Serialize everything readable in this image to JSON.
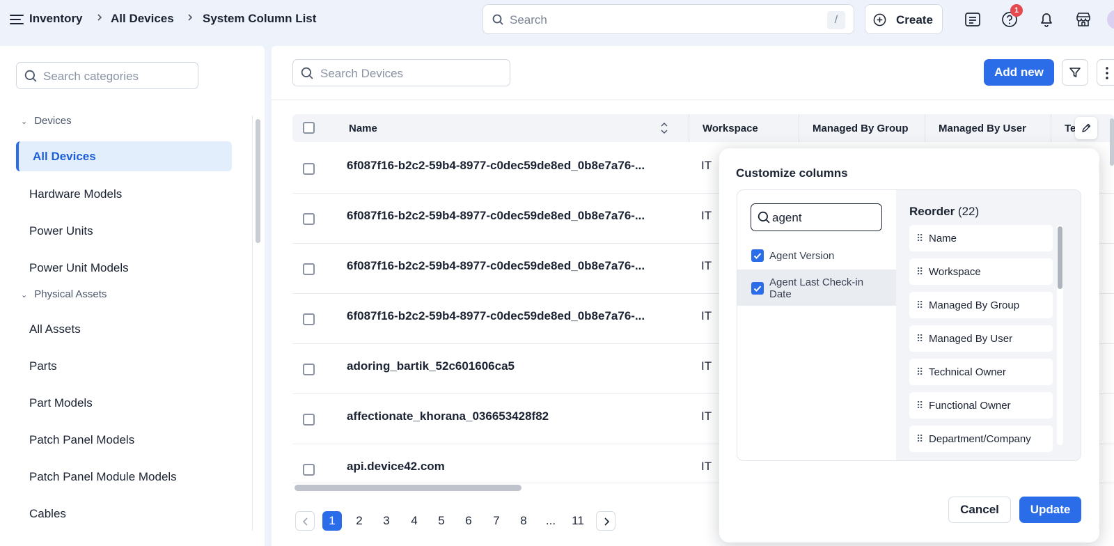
{
  "breadcrumb": {
    "items": [
      "Inventory",
      "All Devices",
      "System Column List"
    ]
  },
  "header": {
    "search_placeholder": "Search",
    "search_shortcut": "/",
    "create_label": "Create",
    "notification_badge": "1"
  },
  "sidebar": {
    "search_placeholder": "Search categories",
    "groups": [
      {
        "label": "Devices",
        "items": [
          "All Devices",
          "Hardware Models",
          "Power Units",
          "Power Unit Models"
        ]
      },
      {
        "label": "Physical Assets",
        "items": [
          "All Assets",
          "Parts",
          "Part Models",
          "Patch Panel Models",
          "Patch Panel Module Models",
          "Cables"
        ]
      }
    ],
    "active_item": "All Devices"
  },
  "main": {
    "search_placeholder": "Search Devices",
    "add_new_label": "Add new",
    "table": {
      "columns": [
        "Name",
        "Workspace",
        "Managed By Group",
        "Managed By User",
        "Te"
      ],
      "rows": [
        {
          "name": "6f087f16-b2c2-59b4-8977-c0dec59de8ed_0b8e7a76-...",
          "workspace": "IT"
        },
        {
          "name": "6f087f16-b2c2-59b4-8977-c0dec59de8ed_0b8e7a76-...",
          "workspace": "IT"
        },
        {
          "name": "6f087f16-b2c2-59b4-8977-c0dec59de8ed_0b8e7a76-...",
          "workspace": "IT"
        },
        {
          "name": "6f087f16-b2c2-59b4-8977-c0dec59de8ed_0b8e7a76-...",
          "workspace": "IT"
        },
        {
          "name": "adoring_bartik_52c601606ca5",
          "workspace": "IT"
        },
        {
          "name": "affectionate_khorana_036653428f82",
          "workspace": "IT"
        },
        {
          "name": "api.device42.com",
          "workspace": "IT"
        }
      ]
    },
    "pagination": {
      "pages": [
        "1",
        "2",
        "3",
        "4",
        "5",
        "6",
        "7",
        "8",
        "...",
        "11"
      ],
      "current": "1"
    }
  },
  "customize": {
    "title": "Customize columns",
    "search_value": "agent",
    "results": [
      {
        "label": "Agent Version",
        "checked": true
      },
      {
        "label": "Agent Last Check-in Date",
        "checked": true
      }
    ],
    "reorder_label": "Reorder",
    "reorder_count": "(22)",
    "reorder_items": [
      "Name",
      "Workspace",
      "Managed By Group",
      "Managed By User",
      "Technical Owner",
      "Functional Owner",
      "Department/Company"
    ],
    "cancel_label": "Cancel",
    "update_label": "Update"
  },
  "colors": {
    "accent": "#2b6de8",
    "active_bg": "#e3eefd",
    "badge": "#e5484d"
  }
}
